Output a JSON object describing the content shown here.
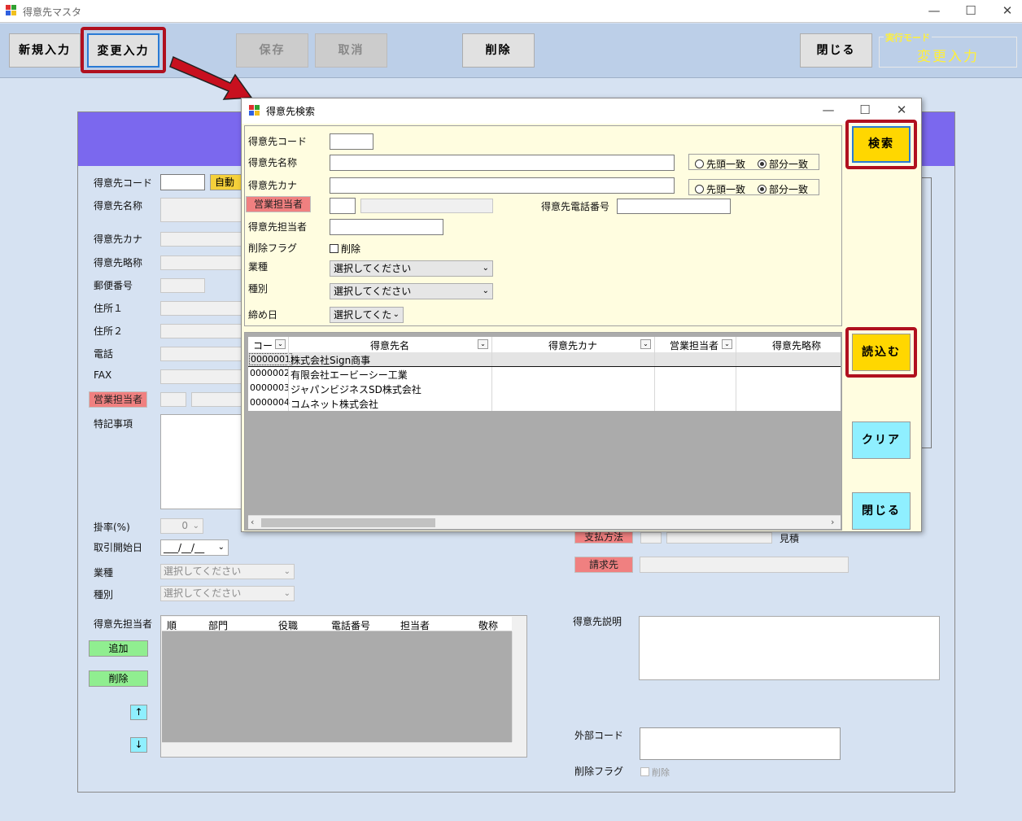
{
  "window": {
    "title": "得意先マスタ"
  },
  "toolbar": {
    "new_entry": "新規入力",
    "change_entry": "変更入力",
    "save": "保存",
    "cancel": "取消",
    "delete": "削除",
    "close": "閉じる",
    "mode_label": "実行モード",
    "mode_value": "変更入力"
  },
  "form": {
    "code": "得意先コード",
    "auto_number": "自動",
    "name": "得意先名称",
    "kana": "得意先カナ",
    "abbr": "得意先略称",
    "postal": "郵便番号",
    "address1": "住所１",
    "address2": "住所２",
    "phone": "電話",
    "fax": "FAX",
    "sales_rep": "営業担当者",
    "notes": "特記事項",
    "rate": "掛率(%)",
    "rate_value": "0",
    "start_date": "取引開始日",
    "start_date_value": "___/__/__",
    "industry": "業種",
    "type": "種別",
    "select_placeholder": "選択してください",
    "contacts": "得意先担当者",
    "add": "追加",
    "remove": "削除",
    "up": "↑",
    "down": "↓",
    "contact_cols": [
      "順",
      "部門",
      "役職",
      "電話番号",
      "担当者",
      "敬称"
    ],
    "payment_method": "支払方法",
    "estimate": "見積",
    "billing": "請求先",
    "description": "得意先説明",
    "external_code": "外部コード",
    "delete_flag": "削除フラグ",
    "delete_check": "削除"
  },
  "dialog": {
    "title": "得意先検索",
    "code": "得意先コード",
    "name": "得意先名称",
    "kana": "得意先カナ",
    "sales_rep": "営業担当者",
    "phone": "得意先電話番号",
    "contact": "得意先担当者",
    "delete_flag": "削除フラグ",
    "delete_check": "削除",
    "industry": "業種",
    "type": "種別",
    "closing_day": "締め日",
    "select_placeholder": "選択してください",
    "closing_placeholder": "選択してくた",
    "prefix_match": "先頭一致",
    "partial_match": "部分一致",
    "search": "検索",
    "load": "読込む",
    "clear": "クリア",
    "close": "閉じる",
    "columns": [
      "コー",
      "得意先名",
      "得意先カナ",
      "営業担当者",
      "得意先略称"
    ],
    "rows": [
      {
        "code": "0000001",
        "name": "株式会社Sign商事"
      },
      {
        "code": "0000002",
        "name": "有限会社エービーシー工業"
      },
      {
        "code": "0000003",
        "name": "ジャパンビジネスSD株式会社"
      },
      {
        "code": "0000004",
        "name": "コムネット株式会社"
      }
    ]
  },
  "colors": {
    "header": "#7b68ee",
    "dialog_bg": "#fffde0",
    "highlight": "#b0101f",
    "search_btn": "#ffd700",
    "clear_btn": "#8fefff"
  }
}
